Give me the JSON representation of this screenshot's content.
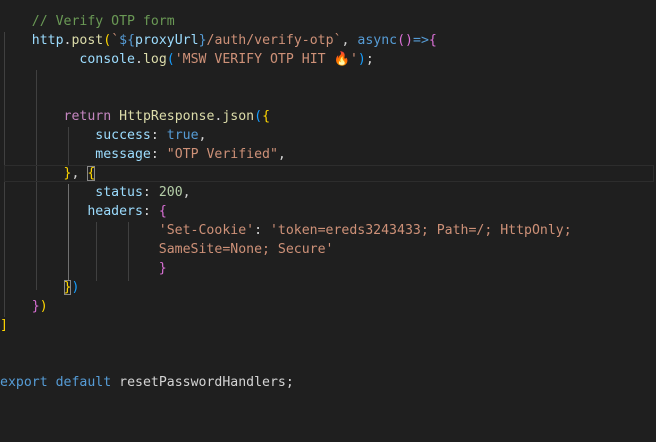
{
  "editor": {
    "line_comment": {
      "indent": "    ",
      "text": "// Verify OTP form"
    },
    "line_post": {
      "indent": "    ",
      "obj": "http",
      "dot": ".",
      "method": "post",
      "paren": "(",
      "tmpl_open": "`",
      "interp_open": "${",
      "interp_var": "proxyUrl",
      "interp_close": "}",
      "tmpl_rest": "/auth/verify-otp`",
      "comma": ", ",
      "async_kw": "async",
      "params": "()",
      "arrow": "=>",
      "brace": "{"
    },
    "line_console": {
      "indent": "          ",
      "obj": "console",
      "dot": ".",
      "method": "log",
      "paren_open": "(",
      "str_text": "'MSW VERIFY OTP HIT ",
      "emoji": "🔥",
      "str_end": "'",
      "paren_close": ")",
      "semi": ";"
    },
    "line_return": {
      "indent": "        ",
      "kw": "return",
      "space": " ",
      "obj": "HttpResponse",
      "dot": ".",
      "method": "json",
      "paren": "(",
      "brace": "{"
    },
    "line_success": {
      "indent": "            ",
      "key": "success",
      "colon": ": ",
      "value": "true",
      "comma": ","
    },
    "line_message": {
      "indent": "            ",
      "key": "message",
      "colon": ": ",
      "value": "\"OTP Verified\"",
      "comma": ","
    },
    "line_close_obj": {
      "indent": "        ",
      "brace": "}",
      "comma": ", ",
      "brace_open": "{"
    },
    "line_status": {
      "indent": "            ",
      "key": "status",
      "colon": ": ",
      "value": "200",
      "comma": ","
    },
    "line_headers": {
      "indent": "           ",
      "key": "headers",
      "colon": ": ",
      "brace": "{"
    },
    "line_cookie": {
      "indent": "                    ",
      "key": "'Set-Cookie'",
      "colon": ": ",
      "value": "'token=ereds3243433; Path=/; HttpOnly;"
    },
    "line_cookie_wrap": {
      "indent": "                    ",
      "value": "SameSite=None; Secure'"
    },
    "line_headers_close": {
      "indent": "                    ",
      "brace": "}"
    },
    "line_options_close": {
      "indent": "        ",
      "brace": "}",
      "paren": ")"
    },
    "line_post_close": {
      "indent": "    ",
      "brace": "}",
      "paren": ")"
    },
    "line_array_close": {
      "bracket": "]"
    },
    "line_export": {
      "kw1": "export",
      "kw2": "default",
      "name": "resetPasswordHandlers",
      "semi": ";",
      "space": " "
    }
  },
  "colors": {
    "background": "#1f1f1f",
    "comment": "#6a9955",
    "function": "#dcdcaa",
    "variable": "#9cdcfe",
    "string": "#ce9178",
    "keyword": "#569cd6",
    "control_keyword": "#c586c0",
    "number": "#b5cea8",
    "bracket_level1": "#ffd700",
    "bracket_level2": "#da70d6",
    "bracket_level3": "#179fff"
  }
}
